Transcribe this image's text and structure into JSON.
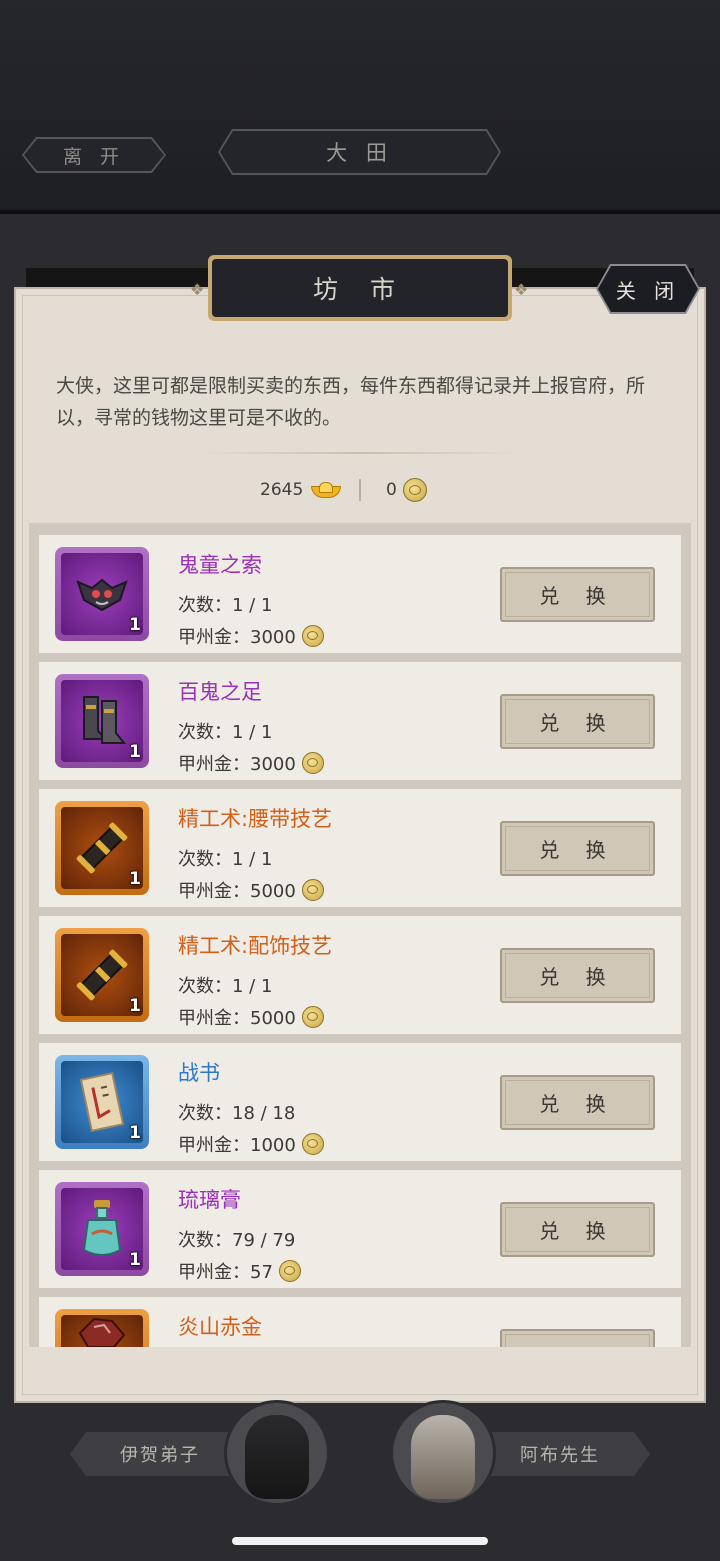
{
  "header": {
    "leave_label": "离 开",
    "location_label": "大 田"
  },
  "shop": {
    "title": "坊 市",
    "close_label": "关 闭",
    "description": "大侠，这里可都是限制买卖的东西，每件东西都得记录并上报官府，所以，寻常的钱物这里可是不收的。",
    "currency_gold": "2645",
    "currency_coin": "0",
    "items": [
      {
        "name": "鬼童之索",
        "count": "次数：1 / 1",
        "price": "甲州金：3000",
        "qty": "1",
        "rarity": "purple",
        "icon": "mask-icon",
        "button": "兑 换"
      },
      {
        "name": "百鬼之足",
        "count": "次数：1 / 1",
        "price": "甲州金：3000",
        "qty": "1",
        "rarity": "purple",
        "icon": "boots-icon",
        "button": "兑 换"
      },
      {
        "name": "精工术:腰带技艺",
        "count": "次数：1 / 1",
        "price": "甲州金：5000",
        "qty": "1",
        "rarity": "orange",
        "icon": "scroll-icon",
        "button": "兑 换"
      },
      {
        "name": "精工术:配饰技艺",
        "count": "次数：1 / 1",
        "price": "甲州金：5000",
        "qty": "1",
        "rarity": "orange",
        "icon": "scroll-icon",
        "button": "兑 换"
      },
      {
        "name": "战书",
        "count": "次数：18 / 18",
        "price": "甲州金：1000",
        "qty": "1",
        "rarity": "blue",
        "icon": "letter-icon",
        "button": "兑 换"
      },
      {
        "name": "琉璃膏",
        "count": "次数：79 / 79",
        "price": "甲州金：57",
        "qty": "1",
        "rarity": "purple",
        "icon": "potion-icon",
        "button": "兑 换"
      },
      {
        "name": "炎山赤金",
        "count": "",
        "price": "",
        "qty": "",
        "rarity": "orange",
        "icon": "ore-icon",
        "button": ""
      }
    ]
  },
  "npcs": {
    "left_name": "伊贺弟子",
    "right_name": "阿布先生"
  },
  "colors": {
    "purple": "#9a2fb8",
    "orange": "#d0611a",
    "blue": "#2b78c9",
    "panel": "#e3ddd4",
    "title_frame": "#c7a871"
  }
}
